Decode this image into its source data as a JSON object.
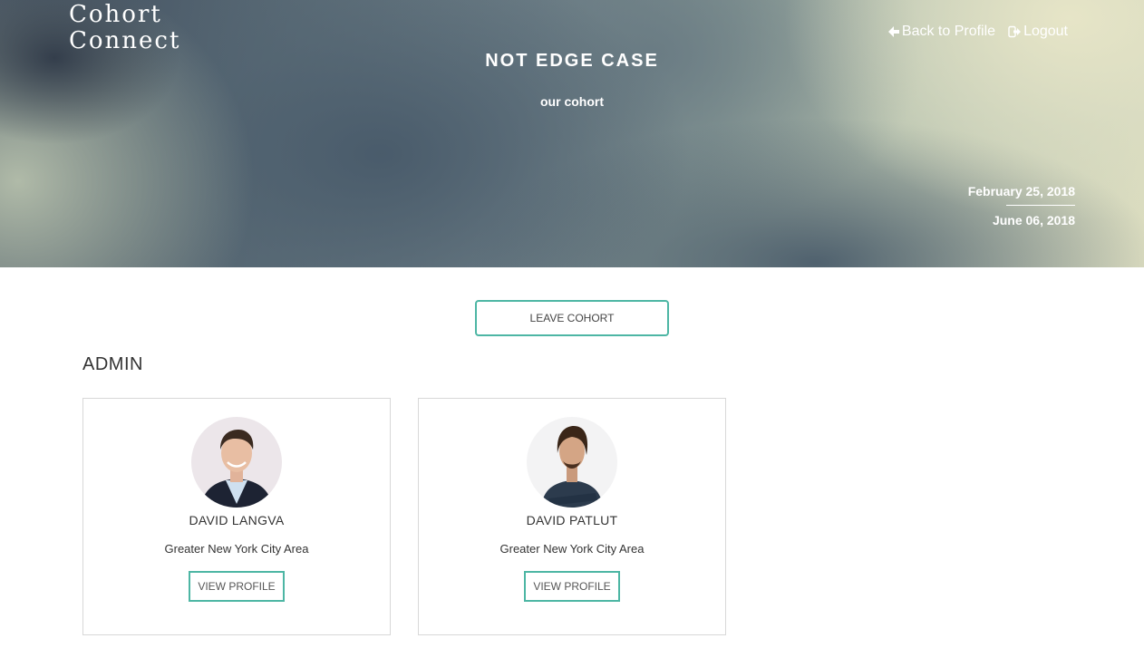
{
  "brand": {
    "line1": "Cohort",
    "line2": "Connect"
  },
  "header": {
    "cohort_name": "NOT EDGE CASE",
    "cohort_tagline": "our cohort",
    "start_date": "February 25, 2018",
    "end_date": "June 06, 2018"
  },
  "nav": {
    "back_label": "Back to Profile",
    "logout_label": "Logout"
  },
  "actions": {
    "leave_label": "LEAVE COHORT"
  },
  "admin_section": {
    "title": "ADMIN",
    "members": [
      {
        "name": "DAVID LANGVA",
        "location": "Greater New York City Area",
        "button_label": "VIEW PROFILE"
      },
      {
        "name": "DAVID PATLUT",
        "location": "Greater New York City Area",
        "button_label": "VIEW PROFILE"
      }
    ]
  },
  "colors": {
    "accent": "#4db6a4",
    "text": "#333333",
    "card_border": "#d8d8d8"
  }
}
